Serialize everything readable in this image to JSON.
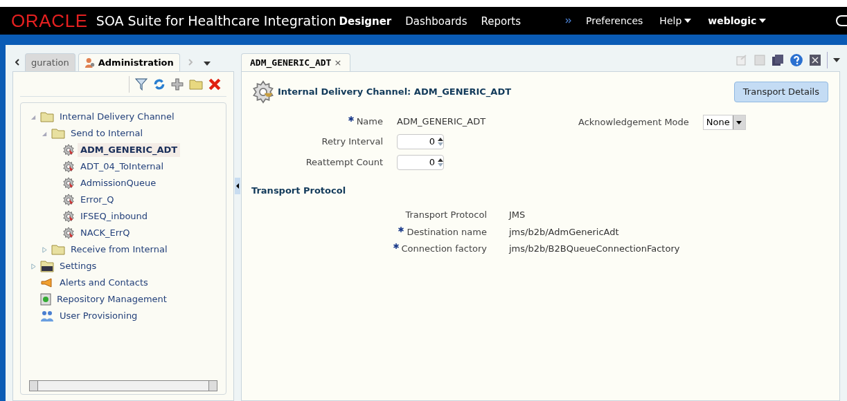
{
  "header": {
    "brand": "ORACLE",
    "product": "SOA Suite for Healthcare Integration",
    "nav": [
      {
        "label": "Designer",
        "selected": true
      },
      {
        "label": "Dashboards",
        "selected": false
      },
      {
        "label": "Reports",
        "selected": false
      }
    ],
    "links": [
      {
        "label": "Preferences",
        "menu": false,
        "bold": false
      },
      {
        "label": "Help",
        "menu": true,
        "bold": false
      },
      {
        "label": "weblogic",
        "menu": true,
        "bold": true
      }
    ]
  },
  "left_tabs": [
    {
      "label": "guration",
      "selected": false
    },
    {
      "label": "Administration",
      "selected": true
    }
  ],
  "tree": [
    {
      "label": "Internal Delivery Channel",
      "kind": "folder",
      "expanded": true,
      "children": [
        {
          "label": "Send to Internal",
          "kind": "folder",
          "expanded": true,
          "children": [
            {
              "label": "ADM_GENERIC_ADT",
              "kind": "channel",
              "selected": true
            },
            {
              "label": "ADT_04_ToInternal",
              "kind": "channel",
              "selected": false
            },
            {
              "label": "AdmissionQueue",
              "kind": "channel",
              "selected": false
            },
            {
              "label": "Error_Q",
              "kind": "channel",
              "selected": false
            },
            {
              "label": "IFSEQ_inbound",
              "kind": "channel",
              "selected": false
            },
            {
              "label": "NACK_ErrQ",
              "kind": "channel",
              "selected": false
            }
          ]
        },
        {
          "label": "Receive from Internal",
          "kind": "folder",
          "expanded": false
        }
      ]
    },
    {
      "label": "Settings",
      "kind": "settings",
      "expanded": false
    },
    {
      "label": "Alerts and Contacts",
      "kind": "alerts"
    },
    {
      "label": "Repository Management",
      "kind": "repository"
    },
    {
      "label": "User Provisioning",
      "kind": "users"
    }
  ],
  "doc_tab": {
    "label": "ADM_GENERIC_ADT",
    "close": "×"
  },
  "title": "Internal Delivery Channel: ADM_GENERIC_ADT",
  "transport_button": "Transport Details",
  "fields": [
    {
      "label": "Name",
      "required": true,
      "kind": "text",
      "value": "ADM_GENERIC_ADT"
    },
    {
      "label": "Retry Interval",
      "required": false,
      "kind": "spinner",
      "value": "0"
    },
    {
      "label": "Reattempt Count",
      "required": false,
      "kind": "spinner",
      "value": "0"
    }
  ],
  "ack": {
    "label": "Acknowledgement Mode",
    "value": "None"
  },
  "section": "Transport Protocol",
  "transport_fields": [
    {
      "label": "Transport Protocol",
      "required": false,
      "value": "JMS"
    },
    {
      "label": "Destination name",
      "required": true,
      "value": "jms/b2b/AdmGenericAdt"
    },
    {
      "label": "Connection factory",
      "required": true,
      "value": "jms/b2b/B2BQueueConnectionFactory"
    }
  ]
}
